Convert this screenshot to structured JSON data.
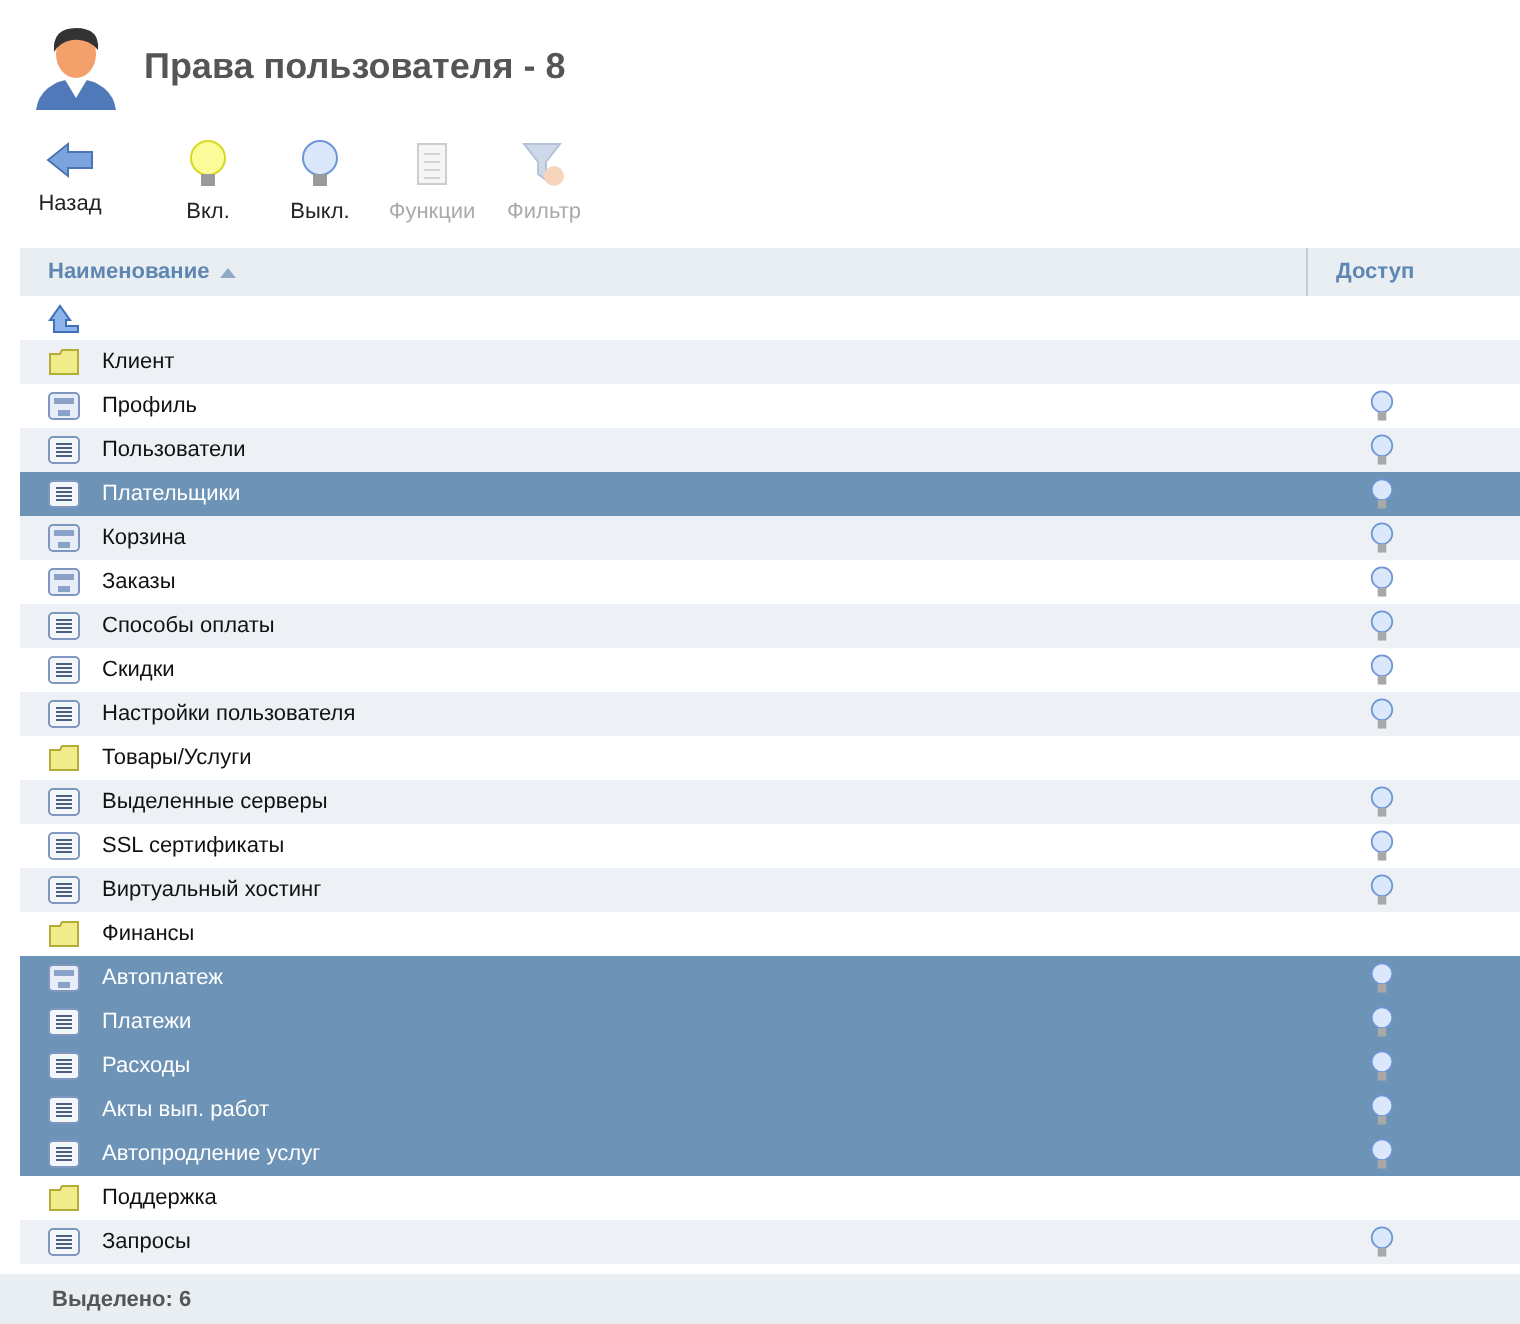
{
  "title": "Права пользователя - 8",
  "toolbar": [
    {
      "kind": "back",
      "label": "Назад",
      "disabled": false
    },
    {
      "kind": "on",
      "label": "Вкл.",
      "disabled": false
    },
    {
      "kind": "off",
      "label": "Выкл.",
      "disabled": false
    },
    {
      "kind": "functions",
      "label": "Функции",
      "disabled": true
    },
    {
      "kind": "filter",
      "label": "Фильтр",
      "disabled": true
    }
  ],
  "table": {
    "columns": [
      {
        "label": "Наименование",
        "sorted_ascending": true
      },
      {
        "label": "Доступ"
      }
    ],
    "rows": [
      {
        "kind": "up",
        "selected": false
      },
      {
        "kind": "folder",
        "name": "Клиент",
        "selected": false
      },
      {
        "kind": "form",
        "name": "Профиль",
        "access_on": false,
        "selected": false
      },
      {
        "kind": "list",
        "name": "Пользователи",
        "access_on": false,
        "selected": false
      },
      {
        "kind": "list",
        "name": "Плательщики",
        "access_on": false,
        "selected": true
      },
      {
        "kind": "form",
        "name": "Корзина",
        "access_on": false,
        "selected": false
      },
      {
        "kind": "form",
        "name": "Заказы",
        "access_on": false,
        "selected": false
      },
      {
        "kind": "list",
        "name": "Способы оплаты",
        "access_on": false,
        "selected": false
      },
      {
        "kind": "list",
        "name": "Скидки",
        "access_on": false,
        "selected": false
      },
      {
        "kind": "list",
        "name": "Настройки пользователя",
        "access_on": false,
        "selected": false
      },
      {
        "kind": "folder",
        "name": "Товары/Услуги",
        "selected": false
      },
      {
        "kind": "list",
        "name": "Выделенные серверы",
        "access_on": false,
        "selected": false
      },
      {
        "kind": "list",
        "name": "SSL сертификаты",
        "access_on": false,
        "selected": false
      },
      {
        "kind": "list",
        "name": "Виртуальный хостинг",
        "access_on": false,
        "selected": false
      },
      {
        "kind": "folder",
        "name": "Финансы",
        "selected": false
      },
      {
        "kind": "form",
        "name": "Автоплатеж",
        "access_on": false,
        "selected": true
      },
      {
        "kind": "list",
        "name": "Платежи",
        "access_on": false,
        "selected": true
      },
      {
        "kind": "list",
        "name": "Расходы",
        "access_on": false,
        "selected": true
      },
      {
        "kind": "list",
        "name": "Акты вып. работ",
        "access_on": false,
        "selected": true
      },
      {
        "kind": "list",
        "name": "Автопродление услуг",
        "access_on": false,
        "selected": true
      },
      {
        "kind": "folder",
        "name": "Поддержка",
        "selected": false
      },
      {
        "kind": "list",
        "name": "Запросы",
        "access_on": false,
        "selected": false
      }
    ]
  },
  "status_bar": "Выделено: 6"
}
